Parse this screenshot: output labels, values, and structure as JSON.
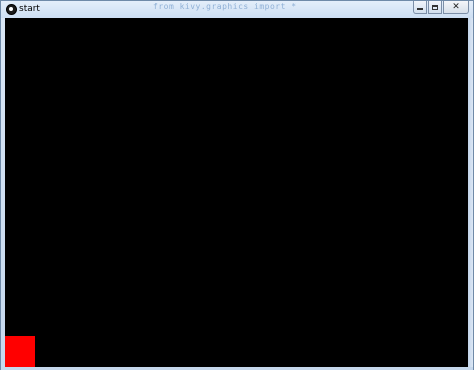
{
  "window": {
    "title": "start",
    "background_text": "from kivy.graphics import *"
  },
  "icons": {
    "app": "app-icon",
    "minimize": "minimize-icon",
    "maximize": "maximize-icon",
    "close": "close-icon"
  },
  "glyphs": {
    "close": "✕"
  },
  "colors": {
    "canvas_background": "#000000",
    "square": "#ff0000"
  }
}
